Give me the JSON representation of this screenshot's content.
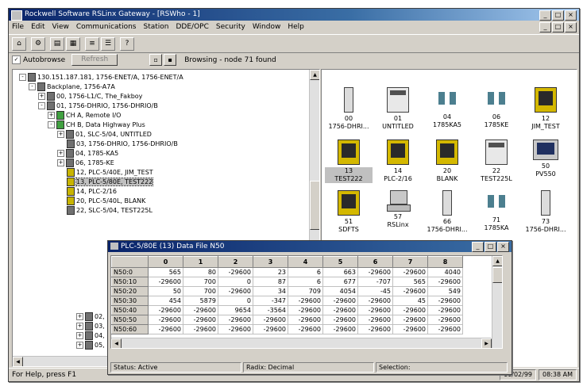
{
  "app": {
    "title": "Rockwell Software RSLinx Gateway - [RSWho - 1]",
    "window_buttons": [
      "_",
      "□",
      "×"
    ]
  },
  "menu": [
    "File",
    "Edit",
    "View",
    "Communications",
    "Station",
    "DDE/OPC",
    "Security",
    "Window",
    "Help"
  ],
  "browse": {
    "autobrowse_label": "Autobrowse",
    "autobrowse_checked": true,
    "refresh_label": "Refresh",
    "status": "Browsing - node 71 found"
  },
  "tree": [
    {
      "label": "130.151.187.181, 1756-ENET/A, 1756-ENET/A",
      "exp": "-"
    },
    {
      "label": "Backplane, 1756-A7A",
      "exp": "-"
    },
    {
      "label": "00, 1756-L1/C, The_Fakboy",
      "exp": "+"
    },
    {
      "label": "01, 1756-DHRIO, 1756-DHRIO/B",
      "exp": "-"
    },
    {
      "label": "CH A, Remote I/O",
      "exp": "+"
    },
    {
      "label": "CH B, Data Highway Plus",
      "exp": "-"
    },
    {
      "label": "01, SLC-5/04, UNTITLED",
      "exp": "+"
    },
    {
      "label": "03, 1756-DHRIO, 1756-DHRIO/B",
      "exp": ""
    },
    {
      "label": "04, 1785-KA5",
      "exp": "+"
    },
    {
      "label": "06, 1785-KE",
      "exp": "+"
    },
    {
      "label": "12, PLC-5/40E, JIM_TEST",
      "exp": ""
    },
    {
      "label": "13, PLC-5/80E, TEST222",
      "exp": "",
      "selected": true
    },
    {
      "label": "14, PLC-2/16",
      "exp": ""
    },
    {
      "label": "20, PLC-5/40L, BLANK",
      "exp": ""
    },
    {
      "label": "22, SLC-5/04, TEST225L",
      "exp": ""
    }
  ],
  "tree_extra": [
    "02,",
    "03,",
    "04,",
    "05,"
  ],
  "devices": [
    {
      "num": "00",
      "name": "1756-DHRI...",
      "icon": "mod"
    },
    {
      "num": "01",
      "name": "UNTITLED",
      "icon": "rack"
    },
    {
      "num": "04",
      "name": "1785KA5",
      "icon": "blue"
    },
    {
      "num": "06",
      "name": "1785KE",
      "icon": "blue"
    },
    {
      "num": "12",
      "name": "JIM_TEST",
      "icon": "yel"
    },
    {
      "num": "13",
      "name": "TEST222",
      "icon": "yel",
      "selected": true
    },
    {
      "num": "14",
      "name": "PLC-2/16",
      "icon": "yel"
    },
    {
      "num": "20",
      "name": "BLANK",
      "icon": "yel"
    },
    {
      "num": "22",
      "name": "TEST225L",
      "icon": "rack"
    },
    {
      "num": "50",
      "name": "PV550",
      "icon": "mon"
    },
    {
      "num": "51",
      "name": "SDFTS",
      "icon": "yel"
    },
    {
      "num": "57",
      "name": "RSLinx",
      "icon": "pc"
    },
    {
      "num": "66",
      "name": "1756-DHRI...",
      "icon": "mod"
    },
    {
      "num": "71",
      "name": "1785KA",
      "icon": "blue"
    },
    {
      "num": "73",
      "name": "1756-DHRI...",
      "icon": "mod"
    }
  ],
  "datafile": {
    "title": "PLC-5/80E (13) Data File N50",
    "columns": [
      "",
      "0",
      "1",
      "2",
      "3",
      "4",
      "5",
      "6",
      "7",
      "8"
    ],
    "rows": [
      {
        "addr": "N50:0",
        "vals": [
          "565",
          "80",
          "-29600",
          "23",
          "6",
          "663",
          "-29600",
          "-29600",
          "4040"
        ]
      },
      {
        "addr": "N50:10",
        "vals": [
          "-29600",
          "700",
          "0",
          "87",
          "6",
          "677",
          "-707",
          "565",
          "-29600"
        ]
      },
      {
        "addr": "N50:20",
        "vals": [
          "50",
          "700",
          "-29600",
          "34",
          "709",
          "4054",
          "-45",
          "-29600",
          "549"
        ]
      },
      {
        "addr": "N50:30",
        "vals": [
          "454",
          "5879",
          "0",
          "-347",
          "-29600",
          "-29600",
          "-29600",
          "45",
          "-29600"
        ]
      },
      {
        "addr": "N50:40",
        "vals": [
          "-29600",
          "-29600",
          "9654",
          "-3564",
          "-29600",
          "-29600",
          "-29600",
          "-29600",
          "-29600"
        ]
      },
      {
        "addr": "N50:50",
        "vals": [
          "-29600",
          "-29600",
          "-29600",
          "-29600",
          "-29600",
          "-29600",
          "-29600",
          "-29600",
          "-29600"
        ]
      },
      {
        "addr": "N50:60",
        "vals": [
          "-29600",
          "-29600",
          "-29600",
          "-29600",
          "-29600",
          "-29600",
          "-29600",
          "-29600",
          "-29600"
        ]
      }
    ],
    "status": "Status: Active",
    "radix": "Radix: Decimal",
    "selection": "Selection:"
  },
  "statusbar": {
    "help": "For Help, press F1",
    "date": "11/02/99",
    "time": "08:38 AM"
  }
}
